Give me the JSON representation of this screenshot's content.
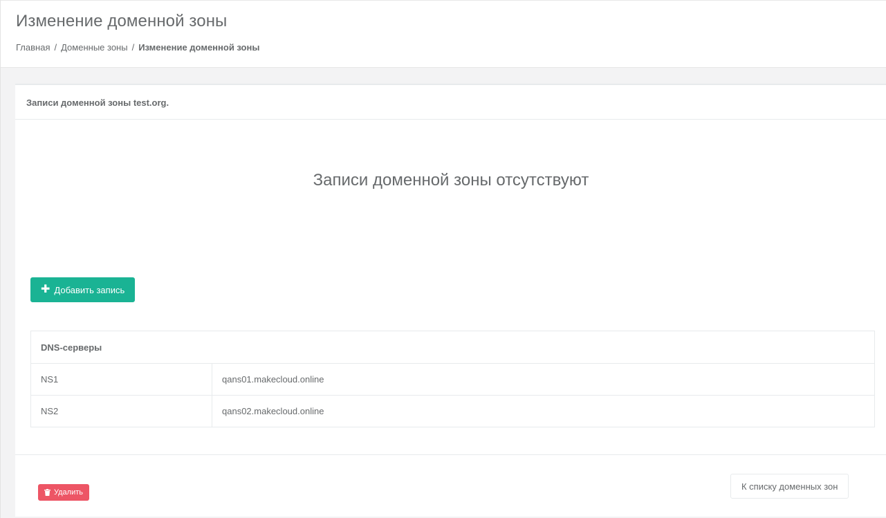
{
  "header": {
    "title": "Изменение доменной зоны",
    "breadcrumb": {
      "home": "Главная",
      "zones": "Доменные зоны",
      "current": "Изменение доменной зоны",
      "separator": "/"
    }
  },
  "records": {
    "title": "Записи доменной зоны test.org.",
    "empty_message": "Записи доменной зоны отсутствуют",
    "add_button": "Добавить запись"
  },
  "dns": {
    "title": "DNS-серверы",
    "rows": [
      {
        "key": "NS1",
        "value": "qans01.makecloud.online"
      },
      {
        "key": "NS2",
        "value": "qans02.makecloud.online"
      }
    ]
  },
  "footer": {
    "delete_button": "Удалить",
    "back_button": "К списку доменных зон"
  },
  "colors": {
    "primary": "#1ab394",
    "danger": "#ed5565",
    "text": "#676a6c"
  },
  "icons": {
    "add": "plus-icon",
    "delete": "trash-icon"
  }
}
